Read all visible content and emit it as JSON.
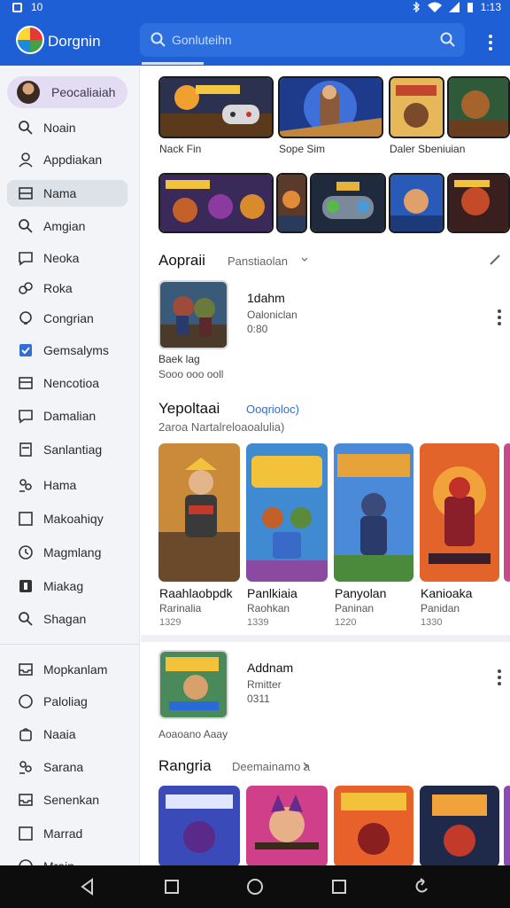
{
  "status_bar": {
    "time": "1:13",
    "left_text": "10"
  },
  "app": {
    "title": "Dorgnin"
  },
  "search": {
    "placeholder": "Gonluteihn"
  },
  "sidebar": {
    "profile_label": "Peocaliaiah",
    "items": [
      {
        "label": "Noain",
        "icon": "search-icon"
      },
      {
        "label": "Appdiakan",
        "icon": "person-icon"
      },
      {
        "label": "Nama",
        "icon": "list-icon"
      },
      {
        "label": "Amgian",
        "icon": "search-icon"
      },
      {
        "label": "Neoka",
        "icon": "chat-icon"
      },
      {
        "label": "Roka",
        "icon": "link-icon"
      },
      {
        "label": "Congrian",
        "icon": "bulb-icon"
      },
      {
        "label": "Gemsalyms",
        "icon": "checkbox-icon"
      },
      {
        "label": "Nencotioa",
        "icon": "mail-icon"
      },
      {
        "label": "Damalian",
        "icon": "chat-icon"
      },
      {
        "label": "Sanlantiag",
        "icon": "document-icon"
      },
      {
        "label": "Hama",
        "icon": "people-icon"
      },
      {
        "label": "Makoahiqy",
        "icon": "square-icon"
      },
      {
        "label": "Magmlang",
        "icon": "clock-icon"
      },
      {
        "label": "Miakag",
        "icon": "box-icon"
      },
      {
        "label": "Shagan",
        "icon": "search-icon"
      },
      {
        "label": "Mopkanlam",
        "icon": "inbox-icon"
      },
      {
        "label": "Paloliag",
        "icon": "circle-icon"
      },
      {
        "label": "Naaia",
        "icon": "bag-icon"
      },
      {
        "label": "Sarana",
        "icon": "people-icon"
      },
      {
        "label": "Senenkan",
        "icon": "inbox-icon"
      },
      {
        "label": "Marrad",
        "icon": "square-icon"
      },
      {
        "label": "Mrain",
        "icon": "globe-icon"
      }
    ]
  },
  "featured": {
    "captions": [
      "Nack Fin",
      "Sope Sim",
      "Daler Sbeniuian"
    ]
  },
  "section_one": {
    "title": "Aopraii",
    "subtitle": "Panstiaolan",
    "app": {
      "name": "1dahm",
      "developer": "Oaloniclan",
      "price": "0:80",
      "caption_1": "Baek lag",
      "caption_2": "Sooo ooo ooll"
    }
  },
  "section_two": {
    "title": "Yepoltaai",
    "link": "Ooqrioloc)",
    "subtitle": "2aroa Nartalreloaoalulia)",
    "games": [
      {
        "title": "Raahlaobpdk",
        "sub": "Rarinalia",
        "year": "1329"
      },
      {
        "title": "Panlkiaia",
        "sub": "Raohkan",
        "year": "1339"
      },
      {
        "title": "Panyolan",
        "sub": "Paninan",
        "year": "1220"
      },
      {
        "title": "Kanioaka",
        "sub": "Panidan",
        "year": "1330"
      }
    ]
  },
  "section_three": {
    "app": {
      "name": "Addnam",
      "developer": "Rmitter",
      "price": "0311",
      "caption": "Aoaoano Aaay"
    }
  },
  "section_four": {
    "title": "Rangria",
    "link": "Deemainamo a"
  },
  "colors": {
    "brand": "#1f5fd6",
    "accent_link": "#2a6fdb",
    "sidebar_bg": "#f3f4f7"
  }
}
